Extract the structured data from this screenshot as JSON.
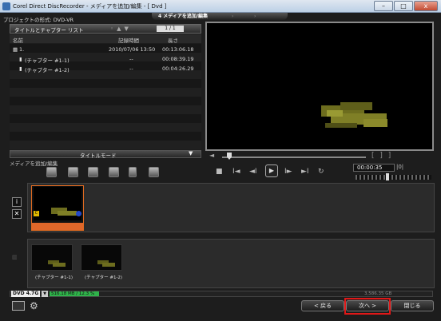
{
  "window": {
    "title": "Corel Direct DiscRecorder - メディアを追加/編集 - [ Dvd ]",
    "minimize_glyph": "–",
    "maximize_glyph": "□",
    "close_glyph": "x"
  },
  "top_tabs": {
    "active": "4 メディアを追加/編集",
    "next": "›",
    "next2": "›"
  },
  "project": {
    "format_label": "プロジェクトの形式: DVD-VR"
  },
  "title_list": {
    "header_label": "タイトルとチャプター リスト",
    "page": "1 / 1",
    "columns": {
      "name": "名前",
      "recorded": "記録時間",
      "length": "長さ"
    },
    "rows": [
      {
        "name": "1.",
        "recorded": "2010/07/06 13:50",
        "length": "00:13:06.18"
      },
      {
        "name": "(チャプター #1-1)",
        "recorded": "--",
        "length": "00:08:39.19"
      },
      {
        "name": "(チャプター #1-2)",
        "recorded": "--",
        "length": "00:04:26.29"
      }
    ],
    "mode_label": "タイトルモード",
    "mode_arrow": "▼"
  },
  "media_edit": {
    "label": "メディアを追加/編集",
    "tools": [
      "add-video-icon",
      "import-icon",
      "chapter-icon",
      "split-icon",
      "lock-icon",
      "capture-icon"
    ]
  },
  "player": {
    "timecode": "00:00:35",
    "time_mode": "|0|",
    "seek_marks": "[ ] ]",
    "seek_left": "◄",
    "buttons": {
      "stop": "■",
      "start": "I◄",
      "prev_frame": "◄I",
      "play": "▶",
      "next_frame": "I►",
      "end": "►I",
      "repeat": "↻"
    }
  },
  "timeline": {
    "info_glyph": "i",
    "delete_glyph": "✕",
    "chapters": [
      {
        "label": "(チャプター #1-1)"
      },
      {
        "label": "(チャプター #1-2)"
      }
    ]
  },
  "disc": {
    "type": "DVD 4.7G",
    "select_glyph": "▼",
    "used": "516.18 MB / 12.3 %",
    "free": "3,586.35 GB"
  },
  "nav": {
    "back": "< 戻る",
    "next": "次へ >",
    "close": "閉じる"
  },
  "colors": {
    "accent_orange": "#e0672a",
    "highlight_red": "#e01818",
    "disc_green": "#2fb34a"
  }
}
